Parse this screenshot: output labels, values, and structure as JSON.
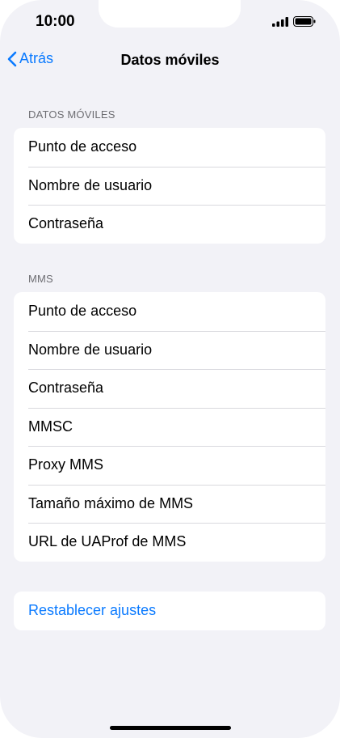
{
  "status_bar": {
    "time": "10:00"
  },
  "nav": {
    "back_label": "Atrás",
    "title": "Datos móviles"
  },
  "sections": [
    {
      "header": "DATOS MÓVILES",
      "rows": [
        "Punto de acceso",
        "Nombre de usuario",
        "Contraseña"
      ]
    },
    {
      "header": "MMS",
      "rows": [
        "Punto de acceso",
        "Nombre de usuario",
        "Contraseña",
        "MMSC",
        "Proxy MMS",
        "Tamaño máximo de MMS",
        "URL de UAProf de MMS"
      ]
    }
  ],
  "reset": {
    "label": "Restablecer ajustes"
  },
  "colors": {
    "accent": "#0a7aff",
    "background": "#f2f2f7",
    "card": "#ffffff",
    "section_header": "#6d6d72"
  },
  "icons": [
    "signal-bars-icon",
    "battery-icon",
    "chevron-left-icon"
  ]
}
